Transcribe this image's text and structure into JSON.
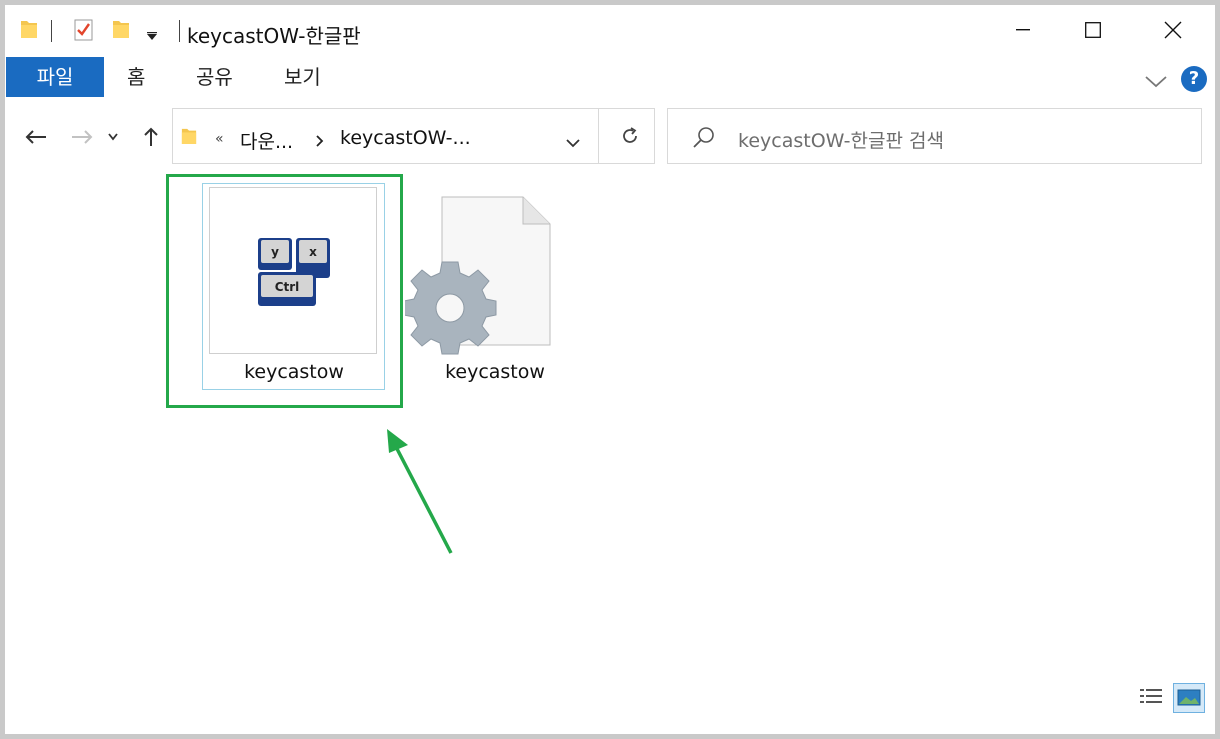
{
  "window": {
    "title": "keycastOW-한글판"
  },
  "ribbon": {
    "tabs": [
      "파일",
      "홈",
      "공유",
      "보기"
    ],
    "help_label": "?"
  },
  "navigation": {
    "breadcrumb_overflow": "«",
    "breadcrumb": [
      "다운...",
      "keycastOW-..."
    ]
  },
  "search": {
    "placeholder": "keycastOW-한글판 검색"
  },
  "files": [
    {
      "name": "keycastow",
      "icon": "keycastow-app-icon",
      "selected": true
    },
    {
      "name": "keycastow",
      "icon": "config-file-gear-icon",
      "selected": false
    }
  ],
  "colors": {
    "accent": "#1a6bc1",
    "highlight_green": "#24a84a",
    "selection_border": "#99d1e6"
  }
}
